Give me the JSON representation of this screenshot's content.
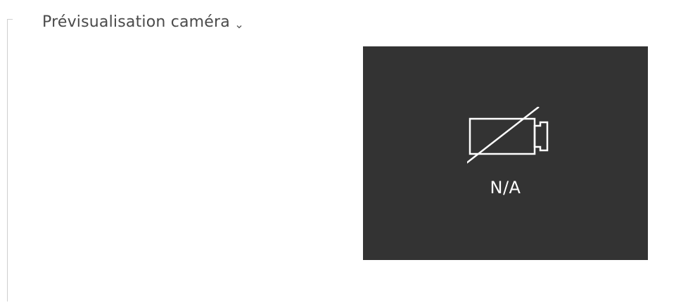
{
  "section": {
    "title": "Prévisualisation caméra",
    "toggle_icon": "chevron-down-icon"
  },
  "camera_preview": {
    "status_text": "N/A",
    "icon": "camera-off-icon",
    "background_color": "#333333",
    "foreground_color": "#ffffff"
  }
}
